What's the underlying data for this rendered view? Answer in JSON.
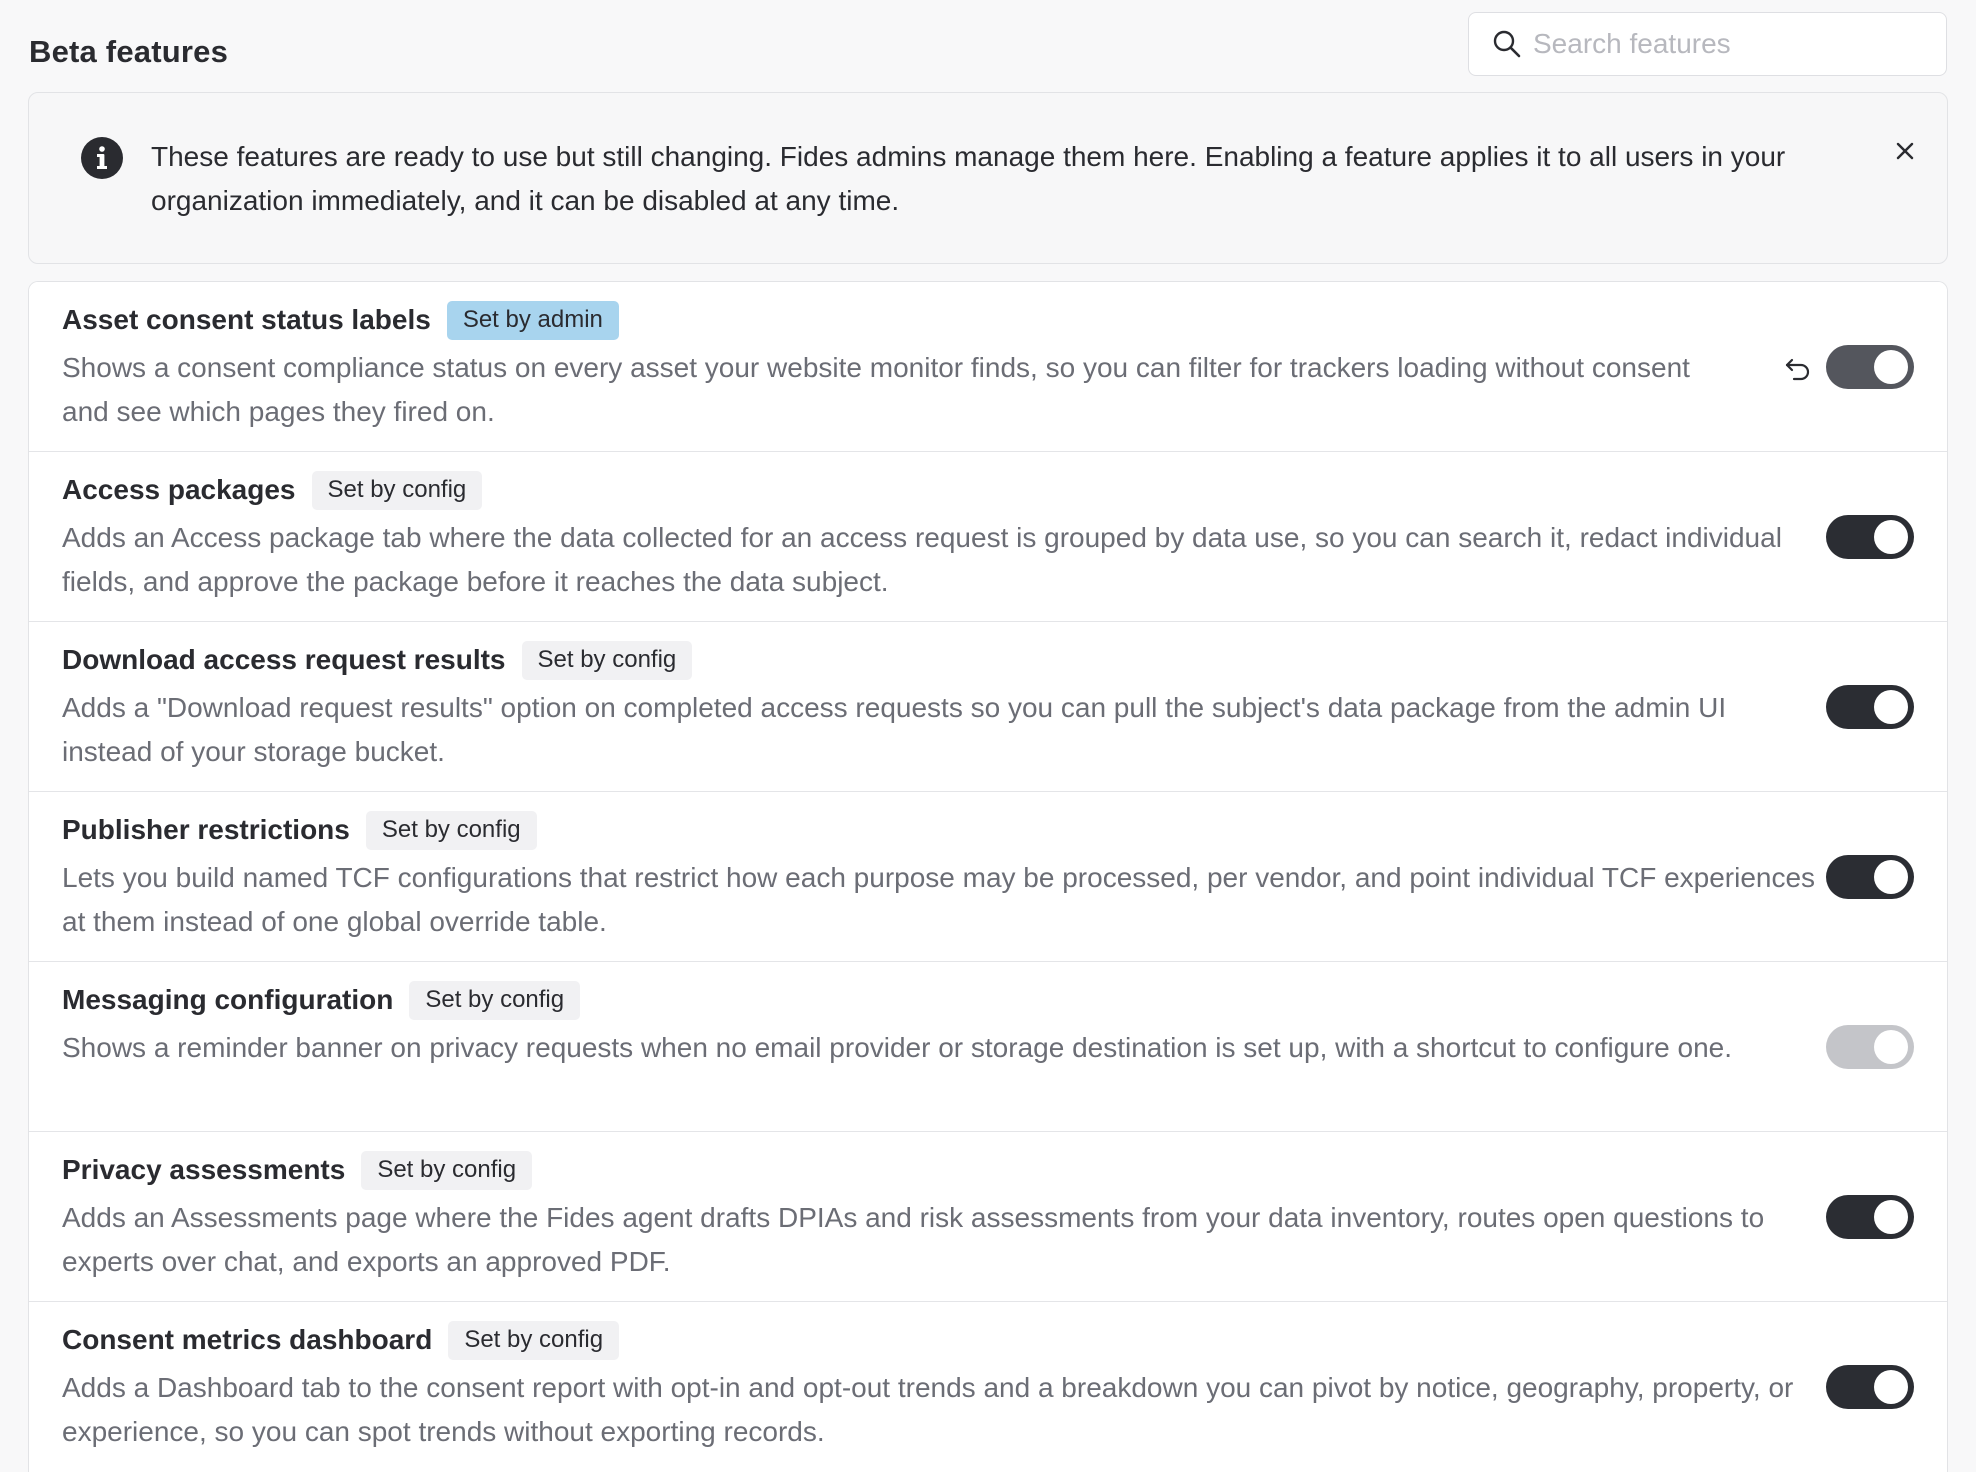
{
  "header": {
    "title": "Beta features",
    "search_placeholder": "Search features",
    "search_value": ""
  },
  "alert": {
    "icon": "info-icon",
    "text": "These features are ready to use but still changing. Fides admins manage them here. Enabling a feature applies it to all users in your organization immediately, and it can be disabled at any time.",
    "close_icon": "close-icon"
  },
  "features": [
    {
      "name": "Asset consent status labels",
      "tag": "Set by admin",
      "description": "Shows a consent compliance status on every asset your website monitor finds, so you can filter for trackers loading without consent and see which pages they fired on.",
      "enabled": true,
      "has_reset": true
    },
    {
      "name": "Access packages",
      "tag": "Set by config",
      "description": "Adds an Access package tab where the data collected for an access request is grouped by data use, so you can search it, redact individual fields, and approve the package before it reaches the data subject.",
      "enabled": true
    },
    {
      "name": "Download access request results",
      "tag": "Set by config",
      "description": "Adds a \"Download request results\" option on completed access requests so you can pull the subject's data package from the admin UI instead of your storage bucket.",
      "enabled": true
    },
    {
      "name": "Publisher restrictions",
      "tag": "Set by config",
      "description": "Lets you build named TCF configurations that restrict how each purpose may be processed, per vendor, and point individual TCF experiences at them instead of one global override table.",
      "enabled": true
    },
    {
      "name": "Messaging configuration",
      "tag": "Set by config",
      "description": "Shows a reminder banner on privacy requests when no email provider or storage destination is set up, with a shortcut to configure one.",
      "enabled": true,
      "disabled_control": true
    },
    {
      "name": "Privacy assessments",
      "tag": "Set by config",
      "description": "Adds an Assessments page where the Fides agent drafts DPIAs and risk assessments from your data inventory, routes open questions to experts over chat, and exports an approved PDF.",
      "enabled": true
    },
    {
      "name": "Consent metrics dashboard",
      "tag": "Set by config",
      "description": "Adds a Dashboard tab to the consent report with opt-in and opt-out trends and a breakdown you can pivot by notice, geography, property, or experience, so you can spot trends without exporting records.",
      "enabled": true
    }
  ]
}
